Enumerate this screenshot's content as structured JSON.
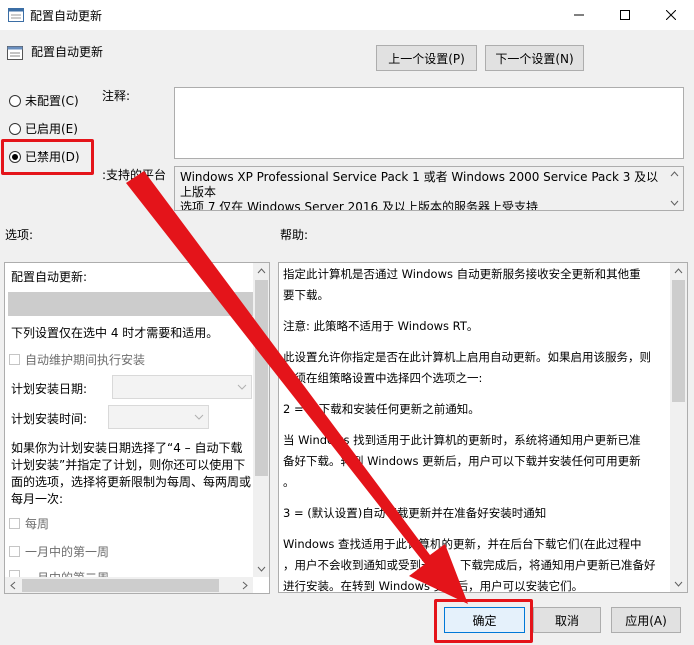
{
  "window": {
    "title": "配置自动更新",
    "header": "配置自动更新"
  },
  "nav": {
    "prev_label": "上一个设置(P)",
    "next_label": "下一个设置(N)"
  },
  "state": {
    "options": [
      {
        "label": "未配置(C)",
        "selected": false
      },
      {
        "label": "已启用(E)",
        "selected": false
      },
      {
        "label": "已禁用(D)",
        "selected": true
      }
    ]
  },
  "comment": {
    "label": "注释:",
    "value": ""
  },
  "platform": {
    "label": "支持的平台:",
    "text": "Windows XP Professional Service Pack 1 或者 Windows 2000 Service Pack 3 及以上版本",
    "text_cut": "选项 7 仅在 Windows Server 2016 及以上版本的服务器上受支持"
  },
  "sections": {
    "options_label": "选项:",
    "help_label": "帮助:"
  },
  "options_panel": {
    "title": "配置自动更新:",
    "note": "下列设置仅在选中 4 时才需要和适用。",
    "maintenance_checkbox": "自动维护期间执行安装",
    "schedule_day_label": "计划安装日期:",
    "schedule_time_label": "计划安装时间:",
    "para_lines": [
      "如果你为计划安装日期选择了“4 – 自动下载",
      "计划安装”并指定了计划，则你还可以使用下",
      "面的选项，选择将更新限制为每周、每两周或",
      "每月一次:"
    ],
    "weekly_checkbox": "每周",
    "first_week_checkbox": "一月中的第一周",
    "second_week_checkbox": "一月中的第二周"
  },
  "help_panel": {
    "lines": [
      "指定此计算机是否通过 Windows 自动更新服务接收安全更新和其他重",
      "要下载。",
      "",
      "注意: 此策略不适用于 Windows RT。",
      "",
      "此设置允许你指定是否在此计算机上启用自动更新。如果启用该服务，则",
      "必须在组策略设置中选择四个选项之一:",
      "",
      "2 = 在下载和安装任何更新之前通知。",
      "",
      "当 Windows 找到适用于此计算机的更新时，系统将通知用户更新已准",
      "备好下载。转到 Windows 更新后，用户可以下载并安装任何可用更新",
      "。",
      "",
      "3 = (默认设置)自动下载更新并在准备好安装时通知",
      "",
      "Windows 查找适用于此计算机的更新，并在后台下载它们(在此过程中",
      "，用户不会收到通知或受到干扰)。下载完成后，将通知用户更新已准备好",
      "进行安装。在转到 Windows 更新后，用户可以安装它们。"
    ]
  },
  "footer": {
    "ok": "确定",
    "cancel": "取消",
    "apply": "应用(A)"
  },
  "colors": {
    "annotation": "#e4141a",
    "selection_border": "#0078d7"
  }
}
